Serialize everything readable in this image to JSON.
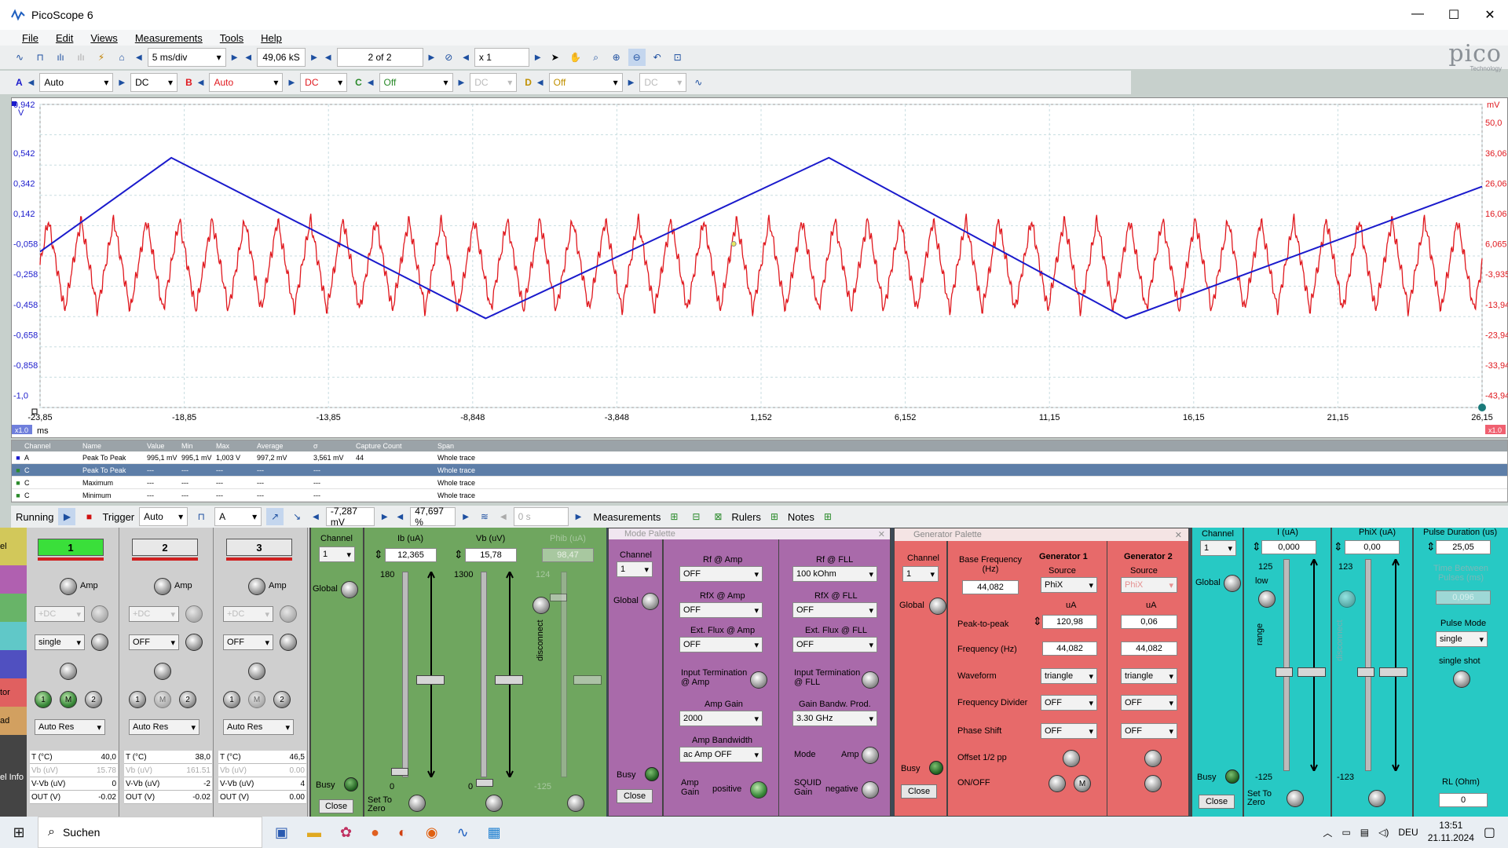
{
  "app": {
    "title": "PicoScope 6",
    "brand": "pico",
    "brand_sub": "Technology"
  },
  "menu": [
    "File",
    "Edit",
    "Views",
    "Measurements",
    "Tools",
    "Help"
  ],
  "toolbar1": {
    "timebase": "5 ms/div",
    "samples": "49,06 kS",
    "buffer": "2 of 2",
    "zoom": "x 1"
  },
  "toolbar2": {
    "channels": [
      {
        "letter": "A",
        "range": "Auto",
        "coupling": "DC"
      },
      {
        "letter": "B",
        "range": "Auto",
        "coupling": "DC"
      },
      {
        "letter": "C",
        "range": "Off",
        "coupling": "DC"
      },
      {
        "letter": "D",
        "range": "Off",
        "coupling": "DC"
      }
    ]
  },
  "scope": {
    "left_top_label": "0,942",
    "left_unit": "V",
    "right_unit": "mV",
    "left_ticks": [
      "0,942",
      "0,542",
      "0,342",
      "0,142",
      "-0,058",
      "-0,258",
      "-0,458",
      "-0,658",
      "-0,858",
      "-1,0"
    ],
    "right_ticks": [
      "50,0",
      "36,06",
      "26,06",
      "16,06",
      "6,065",
      "-3,935",
      "-13,94",
      "-23,94",
      "-33,94",
      "-43,94"
    ],
    "x_ticks": [
      "-23,85",
      "-18,85",
      "-13,85",
      "-8,848",
      "-3,848",
      "1,152",
      "6,152",
      "11,15",
      "16,15",
      "21,15",
      "26,15"
    ],
    "x_unit": "ms",
    "x_zoom_left": "x1.0",
    "x_zoom_right": "x1.0",
    "colors": {
      "channel_a": "#1a1acc",
      "channel_b": "#e0181e"
    }
  },
  "chart_data": {
    "type": "line",
    "title": "",
    "xlabel": "ms",
    "ylabel": "V",
    "xlim": [
      -23.85,
      26.15
    ],
    "series": [
      {
        "name": "A",
        "x": [
          -23.85,
          -19.3,
          -8.4,
          3.5,
          13.8,
          26.15
        ],
        "values": [
          -0.11,
          0.51,
          -0.55,
          0.51,
          -0.55,
          0.32
        ]
      },
      {
        "name": "B",
        "frequency_cycles": 44,
        "amplitude_mV": 15.0,
        "offset_mV": -0.9
      }
    ]
  },
  "measurements": {
    "headers": [
      "Channel",
      "Name",
      "Value",
      "Min",
      "Max",
      "Average",
      "σ",
      "Capture Count",
      "Span"
    ],
    "rows": [
      [
        "A",
        "Peak To Peak",
        "995,1 mV",
        "995,1 mV",
        "1,003 V",
        "997,2 mV",
        "3,561 mV",
        "44",
        "Whole trace"
      ],
      [
        "C",
        "Peak To Peak",
        "---",
        "---",
        "---",
        "---",
        "---",
        "",
        "Whole trace"
      ],
      [
        "C",
        "Maximum",
        "---",
        "---",
        "---",
        "---",
        "---",
        "",
        "Whole trace"
      ],
      [
        "C",
        "Minimum",
        "---",
        "---",
        "---",
        "---",
        "---",
        "",
        "Whole trace"
      ]
    ]
  },
  "status": {
    "running": "Running",
    "trigger_label": "Trigger",
    "trigger_mode": "Auto",
    "trigger_channel": "A",
    "threshold": "-7,287 mV",
    "pretrigger": "47,697 %",
    "delay": "0 s",
    "measurements": "Measurements",
    "rulers": "Rulers",
    "notes": "Notes"
  },
  "left_panel": {
    "side_labels": [
      "el",
      "",
      "",
      "",
      "",
      "tor",
      "ad",
      "",
      "el Info"
    ],
    "columns": [
      {
        "num": "1",
        "amp": "Amp",
        "dc": "+DC",
        "mode": "single",
        "res": "Auto Res",
        "t_label": "T (°C)",
        "t": "40,0",
        "vb_label": "Vb (uV)",
        "vb": "15.78",
        "vvb_label": "V-Vb (uV)",
        "vvb": "0",
        "out_label": "OUT (V)",
        "out": "-0.02"
      },
      {
        "num": "2",
        "amp": "Amp",
        "dc": "+DC",
        "mode": "OFF",
        "res": "Auto Res",
        "t_label": "T (°C)",
        "t": "38,0",
        "vb_label": "Vb (uV)",
        "vb": "161.51",
        "vvb_label": "V-Vb (uV)",
        "vvb": "-2",
        "out_label": "OUT (V)",
        "out": "-0.02"
      },
      {
        "num": "3",
        "amp": "Amp",
        "dc": "+DC",
        "mode": "OFF",
        "res": "Auto Res",
        "t_label": "T (°C)",
        "t": "46,5",
        "vb_label": "Vb (uV)",
        "vb": "0.00",
        "vvb_label": "V-Vb (uV)",
        "vvb": "4",
        "out_label": "OUT (V)",
        "out": "0.00"
      }
    ]
  },
  "green_panel": {
    "channel_label": "Channel",
    "channel": "1",
    "global": "Global",
    "busy": "Busy",
    "close": "Close",
    "set_zero": "Set To Zero",
    "ib_label": "Ib (uA)",
    "ib": "12,365",
    "ib_top": "180",
    "ib_bot": "0",
    "vb_label": "Vb (uV)",
    "vb": "15,78",
    "vb_top": "1300",
    "vb_bot": "0",
    "phib_label": "Phib (uA)",
    "phib": "98,47",
    "phib_top": "124",
    "phib_bot": "-125",
    "disconnect": "disconnect"
  },
  "mode_panel": {
    "title": "Mode Palette",
    "channel_label": "Channel",
    "channel": "1",
    "global": "Global",
    "busy": "Busy",
    "close": "Close",
    "rf_amp_label": "Rf @ Amp",
    "rf_amp": "OFF",
    "rf_fll_label": "Rf @ FLL",
    "rf_fll": "100 kOhm",
    "rfx_amp_label": "RfX @ Amp",
    "rfx_amp": "OFF",
    "rfx_fll_label": "RfX @ FLL",
    "rfx_fll": "OFF",
    "ext_amp_label": "Ext. Flux @ Amp",
    "ext_amp": "OFF",
    "ext_fll_label": "Ext. Flux @ FLL",
    "ext_fll": "OFF",
    "term_amp": "Input Termination @ Amp",
    "term_fll": "Input Termination @ FLL",
    "amp_gain_label": "Amp Gain",
    "amp_gain": "2000",
    "gbp_label": "Gain Bandw. Prod.",
    "gbp": "3.30 GHz",
    "amp_bw_label": "Amp Bandwidth",
    "amp_bw": "ac Amp OFF",
    "mode_label": "Mode",
    "mode": "Amp",
    "amp_gain2_label": "Amp Gain",
    "amp_gain2": "positive",
    "squid_label": "SQUID Gain",
    "squid": "negative"
  },
  "gen_panel": {
    "title": "Generator Palette",
    "channel_label": "Channel",
    "channel": "1",
    "global": "Global",
    "busy": "Busy",
    "close": "Close",
    "base_label": "Base Frequency (Hz)",
    "base": "44,082",
    "gen1": "Generator 1",
    "gen2": "Generator 2",
    "source": "Source",
    "src1": "PhiX",
    "src2": "PhiX",
    "unit": "uA",
    "ptp_label": "Peak-to-peak",
    "ptp1": "120,98",
    "ptp2": "0,06",
    "freq_label": "Frequency (Hz)",
    "freq1": "44,082",
    "freq2": "44,082",
    "wave_label": "Waveform",
    "wave1": "triangle",
    "wave2": "triangle",
    "div_label": "Frequency Divider",
    "div1": "OFF",
    "div2": "OFF",
    "phase_label": "Phase Shift",
    "phase1": "OFF",
    "phase2": "OFF",
    "offset_label": "Offset 1/2 pp",
    "onoff_label": "ON/OFF",
    "m": "M"
  },
  "cyan_panel": {
    "channel_label": "Channel",
    "channel": "1",
    "global": "Global",
    "busy": "Busy",
    "close": "Close",
    "set_zero": "Set To Zero",
    "i_label": "I (uA)",
    "i": "0,000",
    "i_top": "125",
    "i_bot": "-125",
    "low": "low",
    "range": "range",
    "phix_label": "PhiX (uA)",
    "phix": "0,00",
    "phix_top": "123",
    "phix_bot": "-123",
    "disconnect": "disconnect",
    "pulse_dur_label": "Pulse Duration (us)",
    "pulse_dur": "25,05",
    "between_label": "Time Between Pulses (ms)",
    "between": "0,096",
    "pulse_mode_label": "Pulse Mode",
    "pulse_mode": "single",
    "single_shot": "single shot",
    "rl_label": "RL (Ohm)",
    "rl": "0"
  },
  "taskbar": {
    "search": "Suchen",
    "lang": "DEU",
    "time": "13:51",
    "date": "21.11.2024"
  }
}
